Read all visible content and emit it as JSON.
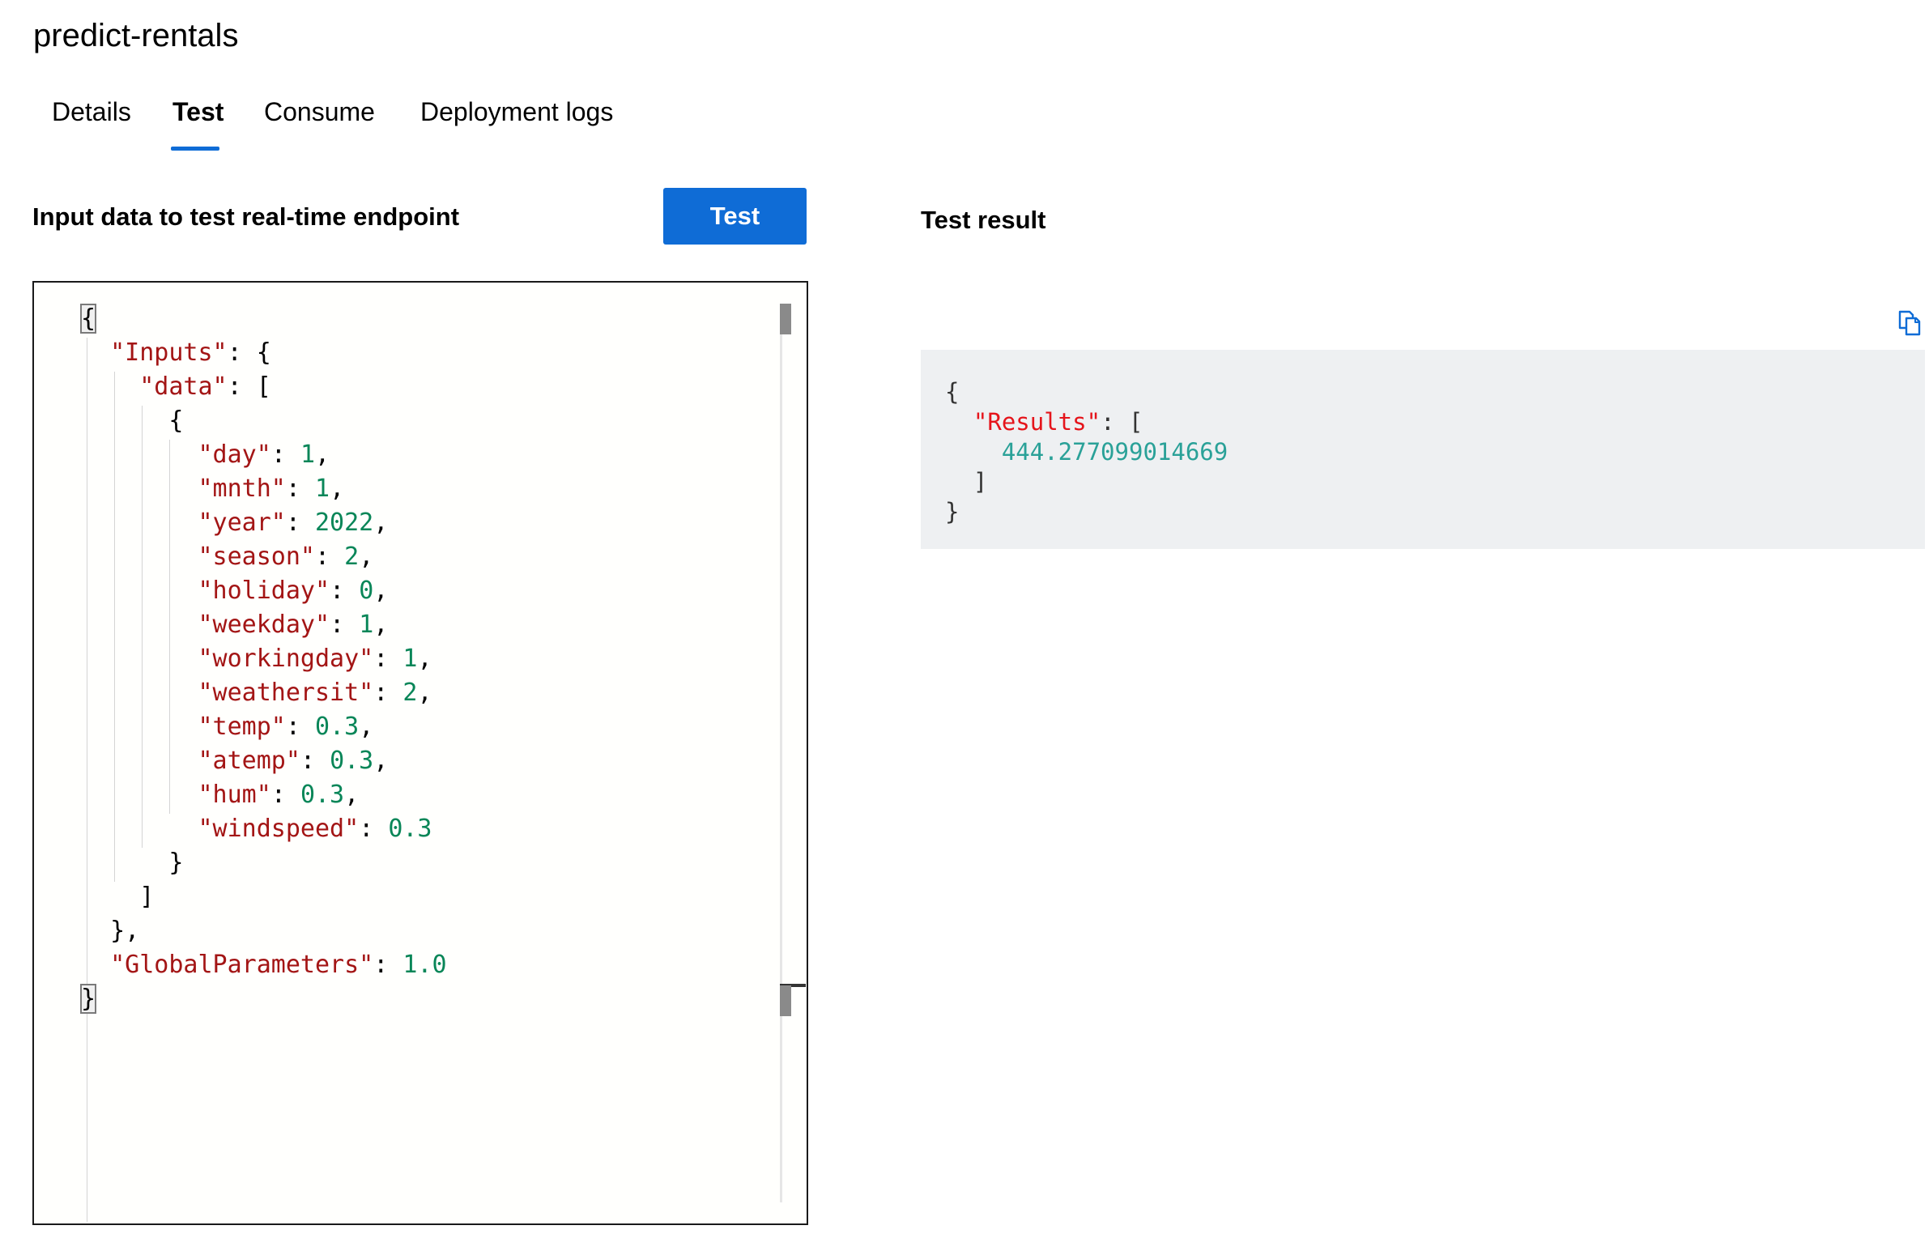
{
  "page_title": "predict-rentals",
  "tabs": [
    {
      "label": "Details",
      "active": false
    },
    {
      "label": "Test",
      "active": true
    },
    {
      "label": "Consume",
      "active": false
    },
    {
      "label": "Deployment logs",
      "active": false
    }
  ],
  "input_section": {
    "heading": "Input data to test real-time endpoint",
    "test_button_label": "Test",
    "json": {
      "open_brace": "{",
      "close_brace": "}",
      "inputs_key": "\"Inputs\"",
      "data_key": "\"data\"",
      "fields": [
        {
          "key": "\"day\"",
          "value": "1"
        },
        {
          "key": "\"mnth\"",
          "value": "1"
        },
        {
          "key": "\"year\"",
          "value": "2022"
        },
        {
          "key": "\"season\"",
          "value": "2"
        },
        {
          "key": "\"holiday\"",
          "value": "0"
        },
        {
          "key": "\"weekday\"",
          "value": "1"
        },
        {
          "key": "\"workingday\"",
          "value": "1"
        },
        {
          "key": "\"weathersit\"",
          "value": "2"
        },
        {
          "key": "\"temp\"",
          "value": "0.3"
        },
        {
          "key": "\"atemp\"",
          "value": "0.3"
        },
        {
          "key": "\"hum\"",
          "value": "0.3"
        },
        {
          "key": "\"windspeed\"",
          "value": "0.3"
        }
      ],
      "global_parameters_key": "\"GlobalParameters\"",
      "global_parameters_value": "1.0"
    }
  },
  "result_section": {
    "heading": "Test result",
    "copy_icon": "copy-icon",
    "json": {
      "open_brace": "{",
      "close_brace": "}",
      "results_key": "\"Results\"",
      "results_values": [
        "444.277099014669"
      ]
    }
  },
  "colors": {
    "accent": "#0f6cd6",
    "json_key": "#a31515",
    "json_number": "#098658",
    "result_key": "#e5141b",
    "result_number": "#2aa198",
    "result_background": "#eef0f2"
  }
}
